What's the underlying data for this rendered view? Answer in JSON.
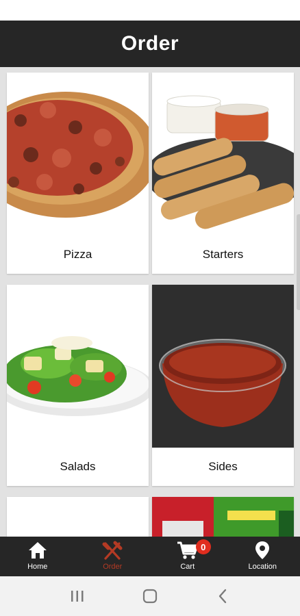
{
  "header": {
    "title": "Order"
  },
  "categories": [
    {
      "label": "Pizza"
    },
    {
      "label": "Starters"
    },
    {
      "label": "Salads"
    },
    {
      "label": "Sides"
    }
  ],
  "bottom_nav": {
    "items": [
      {
        "label": "Home",
        "icon": "home-icon",
        "active": false
      },
      {
        "label": "Order",
        "icon": "fork-knife-icon",
        "active": true
      },
      {
        "label": "Cart",
        "icon": "cart-icon",
        "active": false,
        "badge": "0"
      },
      {
        "label": "Location",
        "icon": "location-pin-icon",
        "active": false
      }
    ]
  },
  "colors": {
    "header_bg": "#262626",
    "active_nav": "#b43a24",
    "badge": "#e02d1e",
    "content_bg": "#e2e2e2"
  }
}
